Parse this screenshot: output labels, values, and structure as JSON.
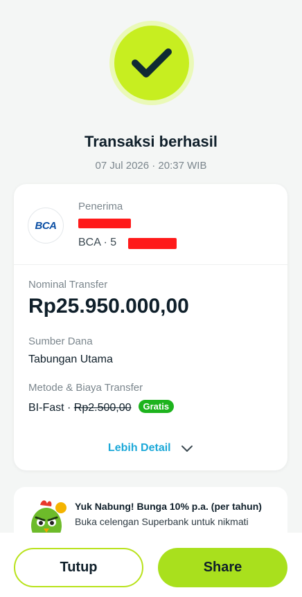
{
  "status": {
    "title": "Transaksi berhasil",
    "datetime": "07 Jul 2026 · 20:37 WIB"
  },
  "recipient": {
    "label": "Penerima",
    "bank_logo_text": "BCA",
    "bank_prefix": "BCA · 5"
  },
  "transfer": {
    "nominal_label": "Nominal Transfer",
    "amount": "Rp25.950.000,00",
    "source_label": "Sumber Dana",
    "source_value": "Tabungan Utama",
    "method_label": "Metode & Biaya Transfer",
    "method_value": "BI-Fast · ",
    "fee": "Rp2.500,00",
    "fee_badge": "Gratis"
  },
  "detail_link": "Lebih Detail",
  "promo": {
    "title": "Yuk Nabung! Bunga 10% p.a. (per tahun)",
    "description": "Buka celengan Superbank untuk nikmati"
  },
  "buttons": {
    "close": "Tutup",
    "share": "Share"
  },
  "colors": {
    "accent": "#c7ee20",
    "link": "#1ba8d8",
    "badge": "#1db31d"
  }
}
